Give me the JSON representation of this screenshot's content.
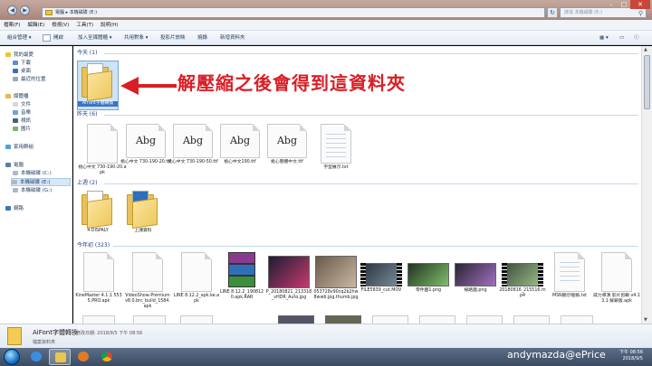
{
  "window": {
    "breadcrumb": [
      "電腦",
      "本機磁碟 (E:)"
    ],
    "search_placeholder": "搜尋 本機磁碟 (E:)",
    "nav_back": "◀",
    "nav_forward": "▶",
    "refresh": "↻"
  },
  "menu": [
    "檔案(F)",
    "編輯(E)",
    "檢視(V)",
    "工具(T)",
    "說明(H)"
  ],
  "toolbar": {
    "organize": "組合管理 ▾",
    "open": "開啟",
    "add_to_library": "加入至媒體櫃 ▾",
    "share": "共用對象 ▾",
    "slideshow": "投影片放映",
    "burn": "燒錄",
    "new_folder": "新增資料夾"
  },
  "nav": {
    "favorites": "我的最愛",
    "favorites_items": [
      "下載",
      "桌面",
      "最近的位置"
    ],
    "libraries": "媒體櫃",
    "library_items": [
      "文件",
      "音樂",
      "視訊",
      "圖片"
    ],
    "homegroup": "家用群組",
    "computer": "電腦",
    "drives": [
      "本機磁碟 (C:)",
      "本機磁碟 (E:)",
      "本機磁碟 (G:)"
    ],
    "network": "網路"
  },
  "groups": {
    "today": "今天 (1)",
    "earlier": "昨天 (6)",
    "last_week": "上週 (2)",
    "this_year": "今年初 (323)"
  },
  "files_today": [
    {
      "name": "AiFont字體轉換"
    }
  ],
  "files_yesterday": [
    {
      "name": "桃心中文 730-190-20.apk",
      "kind": "doc"
    },
    {
      "name": "桃心中文 730-190-20.ttf",
      "kind": "abg",
      "glyph": "Abg"
    },
    {
      "name": "桃心中文 730-190-50.ttf",
      "kind": "abg",
      "glyph": "Abg"
    },
    {
      "name": "桃心中文190.ttf",
      "kind": "abg",
      "glyph": "Abg"
    },
    {
      "name": "桃心簡體中文.ttf",
      "kind": "abg",
      "glyph": "Abg"
    },
    {
      "name": "字型展示.txt",
      "kind": "txt"
    }
  ],
  "files_last_week": [
    {
      "name": "4 DISPALY"
    },
    {
      "name": "上課資料"
    }
  ],
  "files_this_year": [
    {
      "name": "KineMaster 4.1.1 5535.PRO.apk",
      "kind": "doc"
    },
    {
      "name": "VideoShow-Premium v8.0.brc_build_1584.apk",
      "kind": "doc"
    },
    {
      "name": "LINE 8.12.2_apk.ke.apk",
      "kind": "doc"
    },
    {
      "name": "LINE 8.12.2_1908120.apk.RAR",
      "kind": "rar"
    },
    {
      "name": "P_20180821_213318_vHDR_Auto.jpg",
      "kind": "img",
      "c1": "#1b1d33",
      "c2": "#c63a6e"
    },
    {
      "name": "053728v90cq2b2hw8wwb.jpg.thumb.jpg",
      "kind": "img",
      "c1": "#6a5a4a",
      "c2": "#c9b7a2"
    },
    {
      "name": "FILE5839_cut.MOV",
      "kind": "vid",
      "c1": "#28313a",
      "c2": "#7b8f9e"
    },
    {
      "name": "零件圖1.png",
      "kind": "img",
      "c1": "#223322",
      "c2": "#7fbf6a"
    },
    {
      "name": "線路圖.png",
      "kind": "img",
      "c1": "#2a2533",
      "c2": "#a070c0"
    },
    {
      "name": "20180816_215516.mp4",
      "kind": "vid",
      "c1": "#3a4a3a",
      "c2": "#9ec08a"
    },
    {
      "name": "MSN顯示暱稱.txt",
      "kind": "txt"
    },
    {
      "name": "威力導演 影片剪輯 v4.13.1 解鎖版.apk",
      "kind": "doc"
    }
  ],
  "annotation": "解壓縮之後會得到這資料夾",
  "details": {
    "title": "AiFont字體轉換",
    "meta": "修改日期: 2018/9/5 下午 08:56",
    "type": "檔案資料夾"
  },
  "watermark": "andymazda@ePrice",
  "clock": {
    "time": "下午 08:56",
    "date": "2018/9/5"
  },
  "colors": {
    "annotation": "#d91f26",
    "selection": "#cce4fb",
    "folder": "#e8c15c"
  }
}
